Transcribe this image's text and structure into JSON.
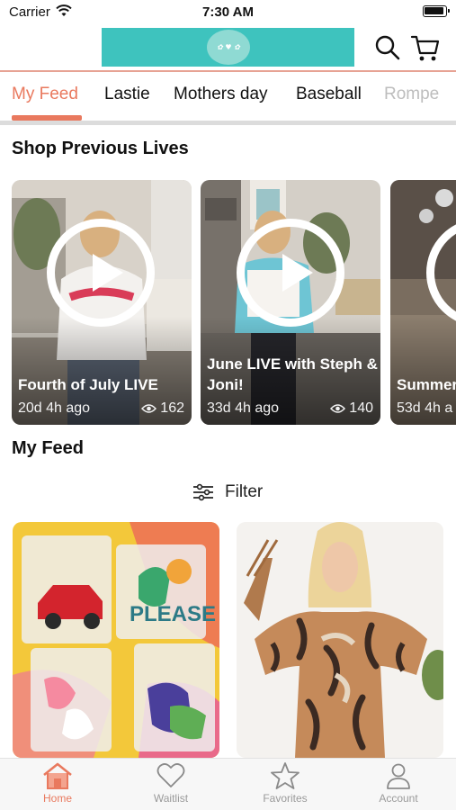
{
  "status_bar": {
    "carrier": "Carrier",
    "time": "7:30 AM"
  },
  "header": {
    "logo_icon": "boutique-logo",
    "search_icon": "search-icon",
    "cart_icon": "cart-icon",
    "brand_color": "#3ec3be"
  },
  "tabs": [
    {
      "label": "My Feed",
      "active": true
    },
    {
      "label": "Lastie"
    },
    {
      "label": "Mothers day"
    },
    {
      "label": "Baseball"
    },
    {
      "label": "Rompe"
    }
  ],
  "sections": {
    "previous_lives": "Shop Previous Lives",
    "my_feed": "My Feed"
  },
  "lives": [
    {
      "title": "Fourth of July LIVE",
      "age": "20d 4h ago",
      "views": "162"
    },
    {
      "title": "June LIVE with Steph & Joni!",
      "age": "33d 4h ago",
      "views": "140"
    },
    {
      "title": "Summer",
      "age": "53d 4h a"
    }
  ],
  "filter": {
    "label": "Filter",
    "icon": "sliders-icon"
  },
  "products": [
    {
      "image": "car-freshie-packs-photo"
    },
    {
      "image": "snakeskin-top-model-photo"
    }
  ],
  "bottom_nav": [
    {
      "label": "Home",
      "icon": "home-icon",
      "active": true
    },
    {
      "label": "Waitlist",
      "icon": "heart-icon"
    },
    {
      "label": "Favorites",
      "icon": "star-icon"
    },
    {
      "label": "Account",
      "icon": "person-icon"
    }
  ],
  "colors": {
    "accent": "#e9795e",
    "divider": "#e7a394"
  }
}
